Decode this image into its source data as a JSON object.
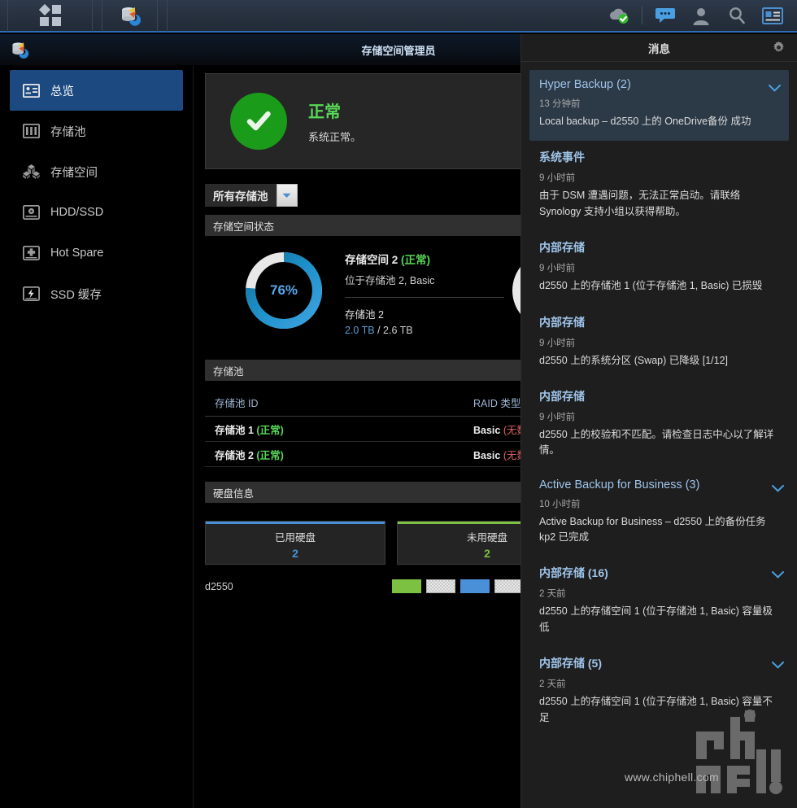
{
  "taskbar": {
    "apps_icon": "app-grid-icon",
    "open_app_icon": "storage-manager-icon",
    "right_icons": [
      {
        "name": "cloud-sync-ok-icon",
        "label": "云同步"
      },
      {
        "name": "notifications-chat-icon",
        "label": "消息"
      },
      {
        "name": "user-account-icon",
        "label": "用户"
      },
      {
        "name": "search-icon",
        "label": "搜索"
      },
      {
        "name": "widgets-icon",
        "label": "小工具"
      }
    ]
  },
  "window": {
    "title": "存储空间管理员",
    "icon": "storage-manager-icon"
  },
  "sidebar": {
    "items": [
      {
        "label": "总览",
        "icon": "overview-icon",
        "active": true
      },
      {
        "label": "存储池",
        "icon": "storage-pool-icon",
        "active": false
      },
      {
        "label": "存储空间",
        "icon": "volume-icon",
        "active": false
      },
      {
        "label": "HDD/SSD",
        "icon": "hdd-icon",
        "active": false
      },
      {
        "label": "Hot Spare",
        "icon": "hot-spare-icon",
        "active": false
      },
      {
        "label": "SSD 缓存",
        "icon": "ssd-cache-icon",
        "active": false
      }
    ]
  },
  "main": {
    "status": {
      "icon": "check-circle-icon",
      "headline": "正常",
      "subtext": "系统正常。",
      "color": "#57d957"
    },
    "pool_selector": {
      "label": "所有存储池",
      "arrow_icon": "chevron-down-icon"
    },
    "volume_section": {
      "header": "存储空间状态",
      "volume": {
        "percent_label": "76%",
        "percent_value": 76,
        "title": "存储空间 2",
        "status": "(正常)",
        "location": "位于存储池 2, Basic",
        "pool_name": "存储池 2",
        "used": "2.0 TB",
        "total": "2.6 TB",
        "capacity_text": "2.0 TB / 2.6 TB"
      }
    },
    "pool_section": {
      "header": "存储池",
      "columns": [
        "存储池 ID",
        "RAID 类型"
      ],
      "rows": [
        {
          "id": "存储池 1",
          "status": "(正常)",
          "raid": "Basic",
          "raid_note": "(无数据保护"
        },
        {
          "id": "存储池 2",
          "status": "(正常)",
          "raid": "Basic",
          "raid_note": "(无数据保护"
        }
      ]
    },
    "disk_section": {
      "header": "硬盘信息",
      "cards": [
        {
          "label": "已用硬盘",
          "value": "2",
          "color": "#4a90d9"
        },
        {
          "label": "未用硬盘",
          "value": "2",
          "color": "#7dc142"
        }
      ],
      "enclosure": {
        "name": "d2550",
        "slots": [
          "green",
          "empty",
          "blue",
          "empty",
          "blue"
        ]
      }
    }
  },
  "notifications": {
    "header": "消息",
    "settings_icon": "gear-icon",
    "items": [
      {
        "title": "Hyper Backup (2)",
        "time": "13 分钟前",
        "message": "Local backup – d2550 上的 OneDrive备份 成功",
        "selected": true,
        "expandable": true,
        "cjk_title": false
      },
      {
        "title": "系统事件",
        "time": "9 小时前",
        "message": "由于 DSM 遭遇问题，无法正常启动。请联络 Synology 支持小组以获得帮助。",
        "selected": false,
        "expandable": false,
        "cjk_title": true
      },
      {
        "title": "内部存储",
        "time": "9 小时前",
        "message": "d2550 上的存储池 1 (位于存储池 1, Basic) 已损毁",
        "selected": false,
        "expandable": false,
        "cjk_title": true
      },
      {
        "title": "内部存储",
        "time": "9 小时前",
        "message": "d2550 上的系统分区 (Swap) 已降级 [1/12]",
        "selected": false,
        "expandable": false,
        "cjk_title": true
      },
      {
        "title": "内部存储",
        "time": "9 小时前",
        "message": "d2550 上的校验和不匹配。请检查日志中心以了解详情。",
        "selected": false,
        "expandable": false,
        "cjk_title": true
      },
      {
        "title": "Active Backup for Business (3)",
        "time": "10 小时前",
        "message": "Active Backup for Business – d2550 上的备份任务 kp2 已完成",
        "selected": false,
        "expandable": true,
        "cjk_title": false
      },
      {
        "title": "内部存储 (16)",
        "time": "2 天前",
        "message": "d2550 上的存储空间 1 (位于存储池 1, Basic) 容量极低",
        "selected": false,
        "expandable": true,
        "cjk_title": true
      },
      {
        "title": "内部存储 (5)",
        "time": "2 天前",
        "message": "d2550 上的存储空间 1 (位于存储池 1, Basic) 容量不足",
        "selected": false,
        "expandable": true,
        "cjk_title": true
      }
    ]
  },
  "watermark": {
    "url": "www.chiphell.com",
    "logo": "chiphell-logo"
  },
  "colors": {
    "accent_blue": "#2e6fb7",
    "ok_green": "#57d957",
    "warn_red": "#e06262",
    "link_blue": "#9fc4ea"
  }
}
